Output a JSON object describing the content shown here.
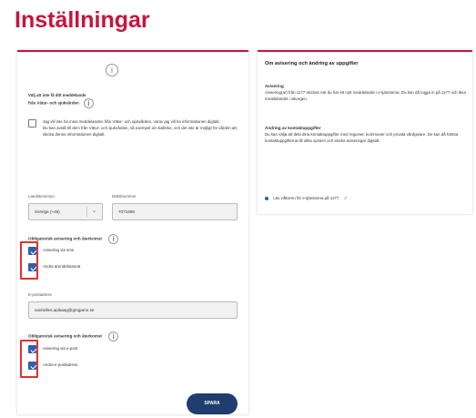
{
  "page": {
    "title": "Inställningar"
  },
  "settings": {
    "heading_line1": "Välj att inte få ditt meddelande",
    "heading_line2": "från Vätur- och sjukvården",
    "no_contact_label": "Jag vill inte ha mina meddelanden från Vätur- och sjukvården, varav jag vill ha informationen digitalt.",
    "no_contact_text": "Du kan avstå till dem från Vätur- och sjukvården, så exempel om kallelse, och det inte är möjligt för vården att skicka denna informationen digitalt.",
    "country_code_label": "Landskommun",
    "country_code_value": "Sverige (+46)",
    "mobile_label": "Mobilnummer",
    "mobile_value": "7071658",
    "sms_group_heading": "Obligatorisk avisering och återkomst",
    "sms_option_1": "Avisering via sms",
    "sms_option_2": "Andra ärendebaserat",
    "email_label": "E-postadress",
    "email_value": "vanhelles.apikaag@gmgamn.se",
    "email_group_heading": "Obligatorisk avisering och återkomst",
    "email_option_1": "Avisering via e-post",
    "email_option_2": "Andra e-postadress",
    "save_label": "SPARA"
  },
  "info_panel": {
    "title": "Om avisering och ändring av uppgifter",
    "section1_head": "Avisering",
    "section1_text": "Avisering(ar) från 1177 skickas när du har ett nytt meddelande i e-tjänsterna. Du kan då logga in på 1177 och läsa meddelandet i inkorgen.",
    "section2_head": "Ändring av kontaktuppgifter",
    "section2_text": "Du kan välja att dela dina kontaktuppgifter med regioner, kommuner och privata vårdgivare. De kan då hämta kontaktuppgifterna till olika system och skicka aviseringar digitalt.",
    "link_text": "Läs villkoren för e-tjänsterna på 1177"
  },
  "icons": {
    "info": "info-circle-icon",
    "chevron": "chevron-down-icon",
    "link_dot": "bullet-icon",
    "link_arrow": "external-link-icon"
  },
  "colors": {
    "brand": "#c8143c",
    "checkbox": "#2f5fad",
    "button": "#1f3d6e",
    "highlight": "#e03030"
  }
}
